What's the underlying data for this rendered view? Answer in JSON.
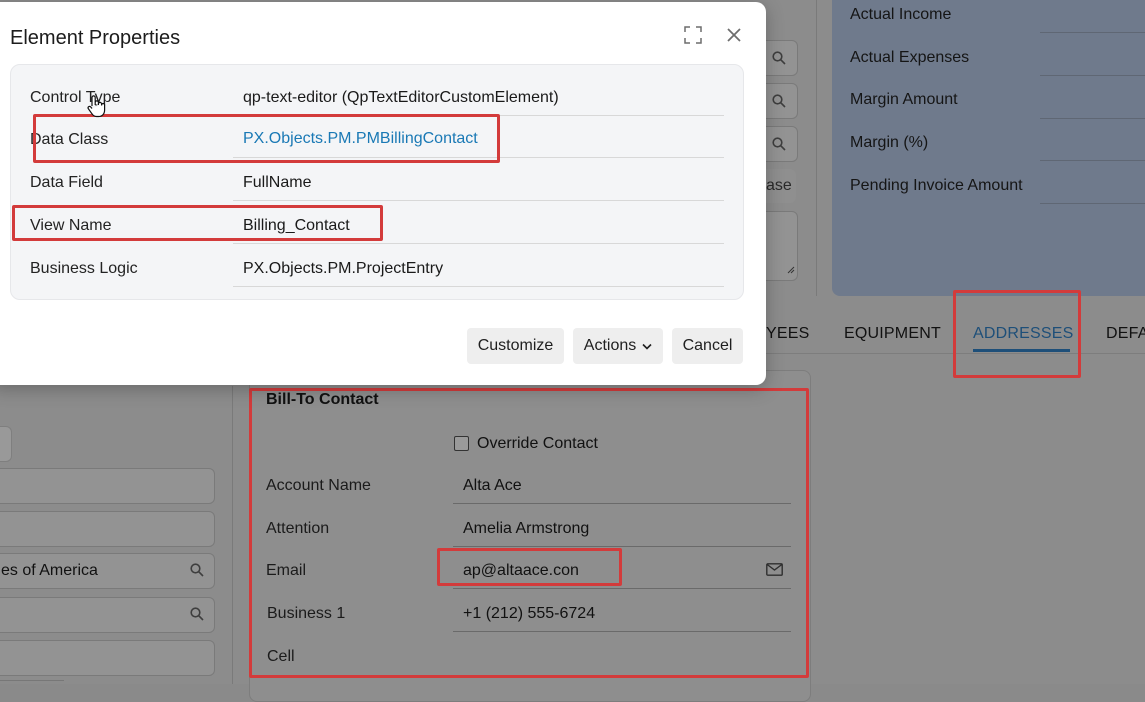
{
  "dialog": {
    "title": "Element Properties",
    "properties": [
      {
        "label": "Control Type",
        "value": "qp-text-editor (QpTextEditorCustomElement)"
      },
      {
        "label": "Data Class",
        "value": "PX.Objects.PM.PMBillingContact"
      },
      {
        "label": "Data Field",
        "value": "FullName"
      },
      {
        "label": "View Name",
        "value": "Billing_Contact"
      },
      {
        "label": "Business Logic",
        "value": "PX.Objects.PM.ProjectEntry"
      }
    ],
    "buttons": {
      "customize": "Customize",
      "actions": "Actions",
      "cancel": "Cancel"
    },
    "icons": {
      "maximize": "maximize-icon",
      "close": "close-icon"
    }
  },
  "summary_panel": {
    "labels": [
      "Actual Income",
      "Actual Expenses",
      "Margin Amount",
      "Margin (%)",
      "Pending Invoice Amount"
    ]
  },
  "background": {
    "partial_button": "ase",
    "country_value": "es of America"
  },
  "tabs": [
    {
      "label": "YEES"
    },
    {
      "label": "EQUIPMENT"
    },
    {
      "label": "ADDRESSES"
    },
    {
      "label": "DEFA"
    }
  ],
  "bill_to_contact": {
    "title": "Bill-To Contact",
    "override_label": "Override Contact",
    "fields": [
      {
        "label": "Account Name",
        "value": "Alta Ace"
      },
      {
        "label": "Attention",
        "value": "Amelia Armstrong"
      },
      {
        "label": "Email",
        "value": "ap@altaace.con"
      },
      {
        "label": "Business 1",
        "value": "+1 (212) 555-6724"
      },
      {
        "label": "Cell",
        "value": ""
      }
    ]
  },
  "colors": {
    "highlight": "#d33b3b",
    "link": "#1a79b5",
    "active_tab": "#1e4f79"
  }
}
